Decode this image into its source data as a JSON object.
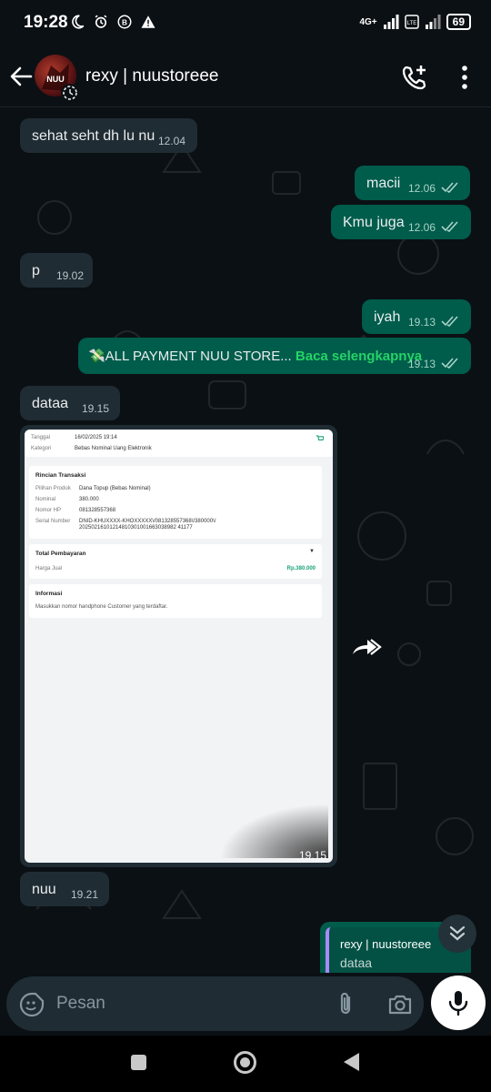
{
  "status_bar": {
    "time": "19:28",
    "network": "4G+",
    "battery": "69"
  },
  "header": {
    "contact_name": "rexy | nuustoreee"
  },
  "messages": [
    {
      "dir": "in",
      "text": "sehat seht dh lu nu",
      "time": "12.04"
    },
    {
      "dir": "out",
      "text": "macii",
      "time": "12.06",
      "status": "read"
    },
    {
      "dir": "out",
      "text": "Kmu juga",
      "time": "12.06",
      "status": "read"
    },
    {
      "dir": "in",
      "text": "p",
      "time": "19.02"
    },
    {
      "dir": "out",
      "text": "iyah",
      "time": "19.13",
      "status": "read"
    },
    {
      "dir": "out",
      "text": "💸ALL PAYMENT NUU STORE... ",
      "link": "Baca selengkapnya",
      "time": "19.13",
      "status": "read"
    },
    {
      "dir": "in",
      "text": "dataa",
      "time": "19.15"
    },
    {
      "dir": "in",
      "type": "image",
      "time": "19.15"
    },
    {
      "dir": "in",
      "text": "nuu",
      "time": "19.21"
    }
  ],
  "receipt": {
    "tanggal_label": "Tanggal",
    "tanggal_value": "16/02/2025 19:14",
    "kategori_label": "Kategori",
    "kategori_value": "Bebas Nominal Uang Elektronik",
    "rincian_title": "Rincian Transaksi",
    "pilihan_label": "Pilihan Produk",
    "pilihan_value": "Dana Topup (Bebas Nominal)",
    "nominal_label": "Nominal",
    "nominal_value": "380.000",
    "nomor_label": "Nomor HP",
    "nomor_value": "081328557368",
    "serial_label": "Serial Number",
    "serial_value_1": "DNID-KHUXXXX-KHOXXXXX\\/081328557368\\/380000\\/",
    "serial_value_2": "20250216101214810301001663038982 41177",
    "total_title": "Total Pembayaran",
    "harga_label": "Harga Jual",
    "harga_value": "Rp.380.000",
    "info_title": "Informasi",
    "info_text": "Masukkan nomor handphone Customer yang terdaftar."
  },
  "reply_preview": {
    "name": "rexy | nuustoreee",
    "text": "dataa"
  },
  "input": {
    "placeholder": "Pesan"
  },
  "colors": {
    "incoming_bubble": "#202c33",
    "outgoing_bubble": "#005c4b",
    "link": "#25d366",
    "background": "#0b1014"
  }
}
